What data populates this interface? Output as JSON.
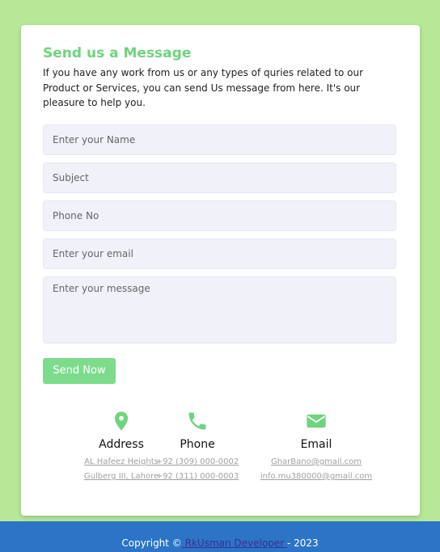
{
  "form": {
    "title": "Send us a Message",
    "description": "If you have any work from us or any types of quries related to our Product or Services, you can send Us message from here. It's our pleasure to help you.",
    "name_placeholder": "Enter your Name",
    "subject_placeholder": "Subject",
    "phone_placeholder": "Phone No",
    "email_placeholder": "Enter your email",
    "message_placeholder": "Enter your message",
    "send_label": "Send Now"
  },
  "contacts": {
    "address": {
      "icon": "map-pin-icon",
      "heading": "Address",
      "line1": "AL Hafeez Heights",
      "line2": "Gulberg III, Lahore"
    },
    "phone": {
      "icon": "phone-icon",
      "heading": "Phone",
      "line1": "+92 (309) 000-0002",
      "line2": "+92 (311) 000-0003"
    },
    "email": {
      "icon": "envelope-icon",
      "heading": "Email",
      "line1": "GharBano@gmail.com",
      "line2": "info.mu380000@gmail.com"
    }
  },
  "footer": {
    "prefix": "Copyright ©",
    "link": " RkUsman Developer ",
    "suffix": "- 2023"
  },
  "colors": {
    "background": "#b7e898",
    "accent": "#6fd47f",
    "button": "#7ddc8c",
    "footer": "#2c74c6"
  }
}
